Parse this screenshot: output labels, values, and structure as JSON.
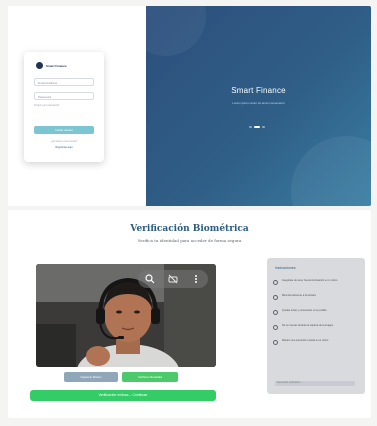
{
  "login": {
    "brand": "Smart Finance",
    "email_placeholder": "Email Address",
    "password_placeholder": "Password",
    "forgot_label": "Forgot your password?",
    "login_button": "Iniciar sesión",
    "signup_prompt": "¿No tienes una cuenta?",
    "signup_link": "Regístrate aquí",
    "hero_title": "Smart Finance",
    "hero_subtitle": "Lorem ipsum dolor sit amet consectetur"
  },
  "biometric": {
    "title": "Verificación Biométrica",
    "subtitle": "Verifica tu identidad para acceder de forma segura",
    "capture_button": "Capturar Rostro",
    "verify_button": "Verificar Identidad",
    "continue_button": "Verificación exitosa – Continuar",
    "instructions_title": "Instrucciones",
    "instructions": [
      "Asegúrate de tener buena iluminación en tu rostro",
      "Mira directamente a la cámara",
      "Quítate lentes y accesorios si es posible",
      "No te muevas durante la captura de la imagen",
      "Mantén una expresión neutral en el rostro"
    ],
    "status_text": "Esperando verificación..."
  },
  "colors": {
    "hero": "#2f5e86",
    "login_button": "#7cc6d2",
    "capture_button": "#8fa7b8",
    "verify_button": "#4cc96a",
    "continue_button": "#34cc66",
    "title": "#2a5c80"
  },
  "icons": {
    "camera_toolbar": [
      "magnify-icon",
      "camera-flip-icon",
      "more-vert-icon"
    ],
    "instruction_marker": "check-circle-icon"
  }
}
